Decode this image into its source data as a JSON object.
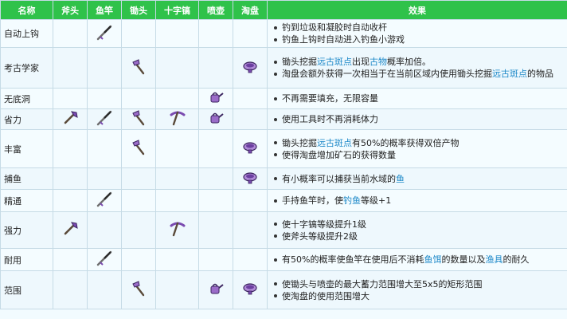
{
  "headers": [
    "名称",
    "斧头",
    "鱼竿",
    "锄头",
    "十字镐",
    "喷壶",
    "淘盘",
    "效果"
  ],
  "rows": [
    {
      "name": "自动上钩",
      "tools": [
        "",
        "rod",
        "",
        "",
        "",
        ""
      ],
      "effects": [
        [
          {
            "t": "钓到垃圾和凝胶时自动收杆"
          }
        ],
        [
          {
            "t": "钓鱼上钩时自动进入钓鱼小游戏"
          }
        ]
      ]
    },
    {
      "name": "考古学家",
      "tools": [
        "",
        "",
        "hoe",
        "",
        "",
        "pan"
      ],
      "effects": [
        [
          {
            "t": "锄头挖掘"
          },
          {
            "t": "远古斑点",
            "link": true
          },
          {
            "t": "出现"
          },
          {
            "t": "古物",
            "link": true
          },
          {
            "t": "概率加倍。"
          }
        ],
        [
          {
            "t": "淘盘会额外获得一次相当于在当前区域内使用锄头挖掘"
          },
          {
            "t": "远古斑点",
            "link": true
          },
          {
            "t": "的物品"
          }
        ]
      ]
    },
    {
      "name": "无底洞",
      "tools": [
        "",
        "",
        "",
        "",
        "can",
        ""
      ],
      "effects": [
        [
          {
            "t": "不再需要填充，无限容量"
          }
        ]
      ]
    },
    {
      "name": "省力",
      "tools": [
        "axe",
        "rod",
        "hoe",
        "pick",
        "can",
        ""
      ],
      "effects": [
        [
          {
            "t": "使用工具时不再消耗体力"
          }
        ]
      ]
    },
    {
      "name": "丰富",
      "tools": [
        "",
        "",
        "hoe",
        "",
        "",
        "pan"
      ],
      "effects": [
        [
          {
            "t": "锄头挖掘"
          },
          {
            "t": "远古斑点",
            "link": true
          },
          {
            "t": "有50%的概率获得双倍产物"
          }
        ],
        [
          {
            "t": "使得淘盘增加矿石的获得数量"
          }
        ]
      ]
    },
    {
      "name": "捕鱼",
      "tools": [
        "",
        "",
        "",
        "",
        "",
        "pan"
      ],
      "effects": [
        [
          {
            "t": "有小概率可以捕获当前水域的"
          },
          {
            "t": "鱼",
            "link": true
          }
        ]
      ]
    },
    {
      "name": "精通",
      "tools": [
        "",
        "rod",
        "",
        "",
        "",
        ""
      ],
      "effects": [
        [
          {
            "t": "手持鱼竿时，使"
          },
          {
            "t": "钓鱼",
            "link": true
          },
          {
            "t": "等级+1"
          }
        ]
      ]
    },
    {
      "name": "强力",
      "tools": [
        "axe",
        "",
        "",
        "pick",
        "",
        ""
      ],
      "effects": [
        [
          {
            "t": "使十字镐等级提升1级"
          }
        ],
        [
          {
            "t": "使斧头等级提升2级"
          }
        ]
      ]
    },
    {
      "name": "耐用",
      "tools": [
        "",
        "rod",
        "",
        "",
        "",
        ""
      ],
      "effects": [
        [
          {
            "t": "有50%的概率使鱼竿在使用后不消耗"
          },
          {
            "t": "鱼饵",
            "link": true
          },
          {
            "t": "的数量以及"
          },
          {
            "t": "渔具",
            "link": true
          },
          {
            "t": "的耐久"
          }
        ]
      ]
    },
    {
      "name": "范围",
      "tools": [
        "",
        "",
        "hoe",
        "",
        "can",
        "pan"
      ],
      "effects": [
        [
          {
            "t": "使锄头与喷壶的最大蓄力范围增大至5x5的矩形范围"
          }
        ],
        [
          {
            "t": "使淘盘的使用范围增大"
          }
        ]
      ]
    }
  ],
  "icons": {
    "axe": "axe-icon",
    "rod": "fishing-rod-icon",
    "hoe": "hoe-icon",
    "pick": "pickaxe-icon",
    "can": "watering-can-icon",
    "pan": "pan-icon"
  },
  "colors": {
    "header": "#2fc24a",
    "link": "#1c88c8",
    "tool": "#7a4bb0"
  }
}
